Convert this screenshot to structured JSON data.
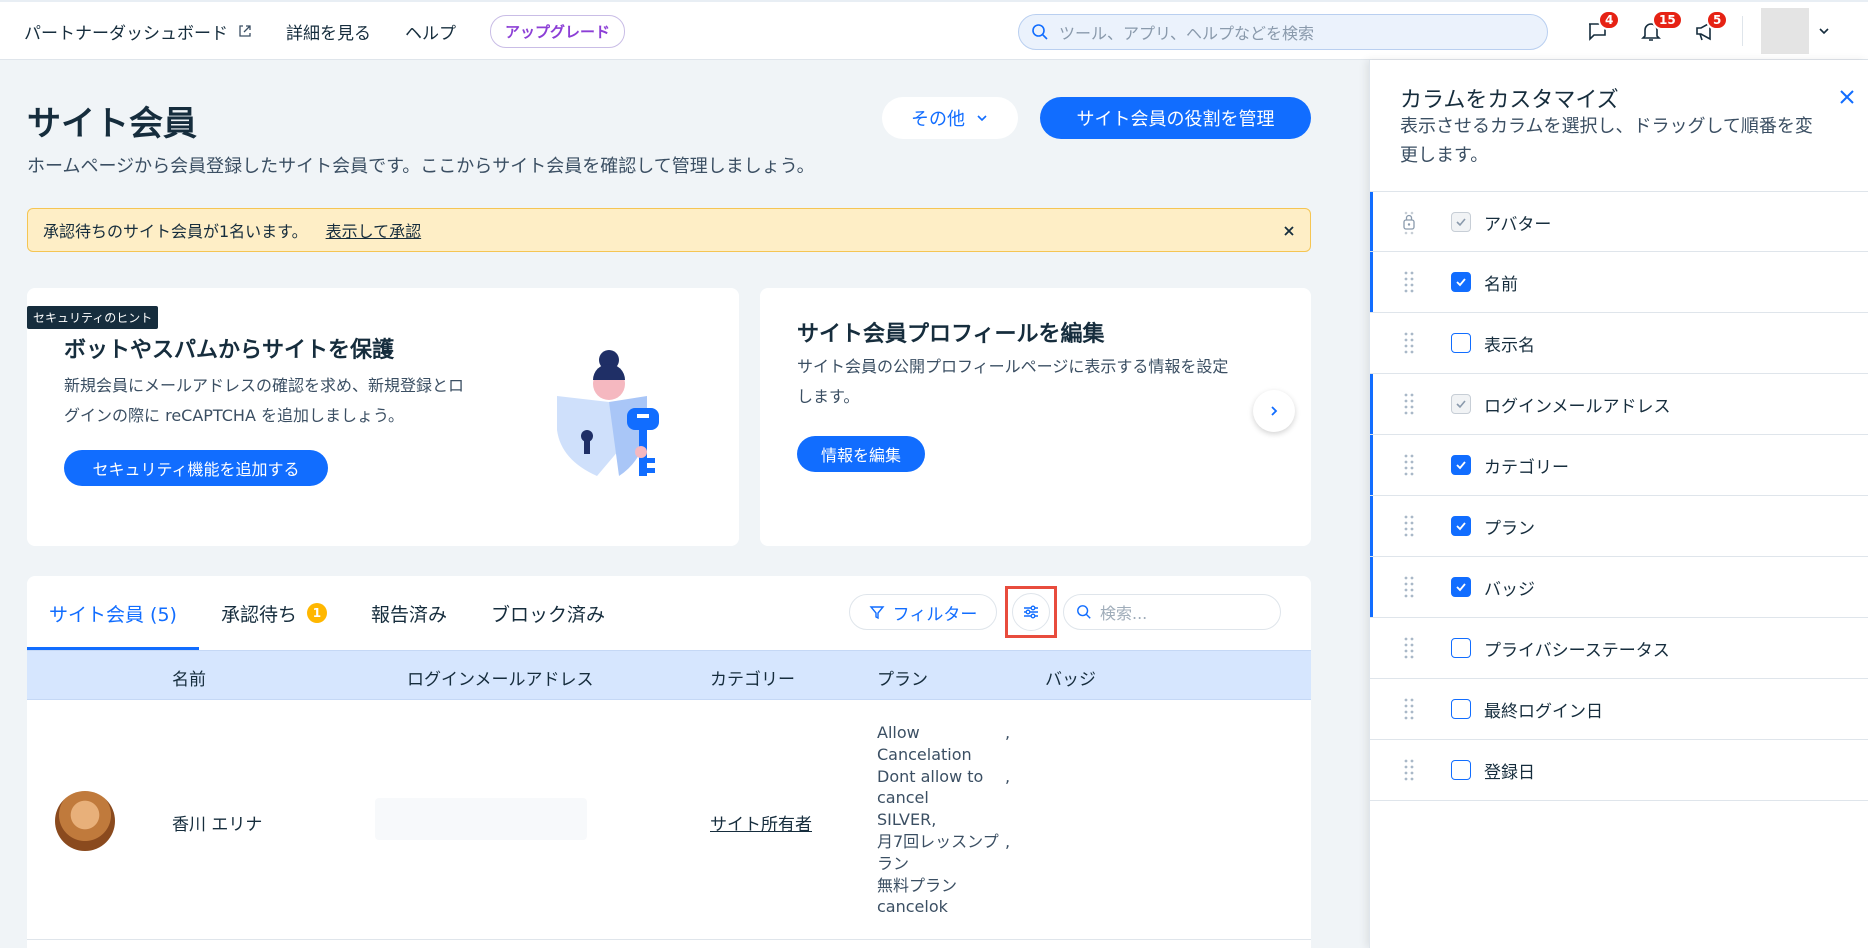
{
  "topbar": {
    "partner_dashboard": "パートナーダッシュボード",
    "details": "詳細を見る",
    "help": "ヘルプ",
    "upgrade": "アップグレード",
    "search_placeholder": "ツール、アプリ、ヘルプなどを検索",
    "badges": {
      "messages": "4",
      "notifications": "15",
      "announcements": "5"
    }
  },
  "page": {
    "title": "サイト会員",
    "subtitle": "ホームページから会員登録したサイト会員です。ここからサイト会員を確認して管理しましょう。",
    "other_button": "その他",
    "manage_roles_button": "サイト会員の役割を管理"
  },
  "notice": {
    "text": "承認待ちのサイト会員が1名います。",
    "link": "表示して承認"
  },
  "card_security": {
    "tag": "セキュリティのヒント",
    "title": "ボットやスパムからサイトを保護",
    "line1": "新規会員にメールアドレスの確認を求め、新規登録とロ",
    "line2": "グインの際に reCAPTCHA を追加しましょう。",
    "button": "セキュリティ機能を追加する"
  },
  "card_profile": {
    "title": "サイト会員プロフィールを編集",
    "line1": "サイト会員の公開プロフィールページに表示する情報を設定",
    "line2": "します。",
    "button": "情報を編集"
  },
  "tabs": [
    {
      "label": "サイト会員 (5)"
    },
    {
      "label": "承認待ち",
      "count": "1"
    },
    {
      "label": "報告済み"
    },
    {
      "label": "ブロック済み"
    }
  ],
  "toolbar": {
    "filter": "フィルター",
    "search_placeholder": "検索..."
  },
  "table": {
    "headers": [
      "名前",
      "ログインメールアドレス",
      "カテゴリー",
      "プラン",
      "バッジ"
    ],
    "row": {
      "name": "香川 エリナ",
      "category": "サイト所有者",
      "plans": [
        "Allow",
        "Cancelation",
        "Dont allow to",
        "cancel",
        "SILVER,",
        "月7回レッスンプ",
        "ラン",
        "無料プラン",
        "cancelok"
      ],
      "comma": ","
    }
  },
  "panel": {
    "title": "カラムをカスタマイズ",
    "subtitle": "表示させるカラムを選択し、ドラッグして順番を変更します。",
    "columns": [
      {
        "label": "アバター",
        "state": "locked"
      },
      {
        "label": "名前",
        "state": "checked"
      },
      {
        "label": "表示名",
        "state": "unchecked"
      },
      {
        "label": "ログインメールアドレス",
        "state": "locked"
      },
      {
        "label": "カテゴリー",
        "state": "checked"
      },
      {
        "label": "プラン",
        "state": "checked"
      },
      {
        "label": "バッジ",
        "state": "checked"
      },
      {
        "label": "プライバシーステータス",
        "state": "unchecked"
      },
      {
        "label": "最終ログイン日",
        "state": "unchecked"
      },
      {
        "label": "登録日",
        "state": "unchecked"
      }
    ]
  },
  "colors": {
    "accent": "#116dff",
    "notice_bg": "#feeec6",
    "badge_red": "#e62214",
    "highlight": "#e84c3d"
  }
}
